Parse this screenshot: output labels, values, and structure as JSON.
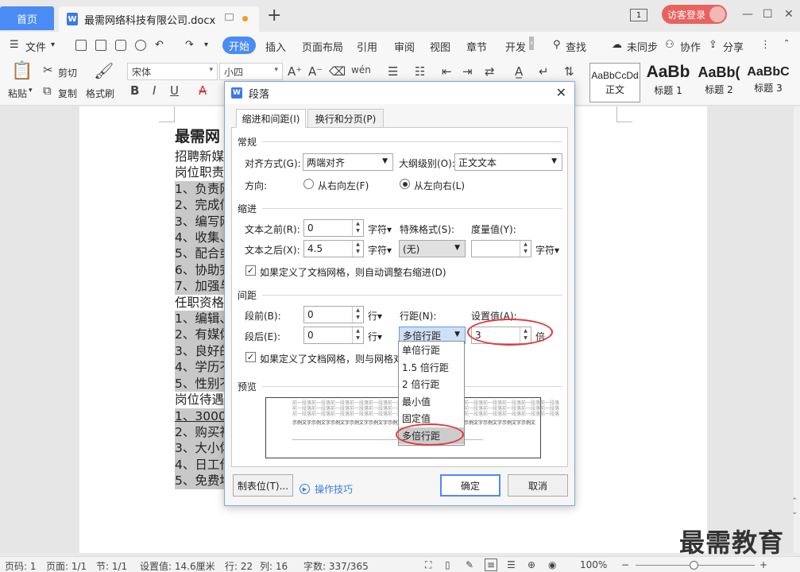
{
  "titlebar": {
    "home_tab": "首页",
    "doc_tab": "最需网络科技有限公司.docx",
    "doc_icon": "W",
    "add_tab": "+",
    "page_count": "1",
    "login": "访客登录",
    "minimize": "—",
    "maximize": "☐",
    "close": "✕"
  },
  "menubar": {
    "file": "文件",
    "start": "开始",
    "items": [
      "插入",
      "页面布局",
      "引用",
      "审阅",
      "视图",
      "章节",
      "开发"
    ],
    "search": "查找",
    "sync": "未同步",
    "collab": "协作",
    "share": "分享"
  },
  "ribbon": {
    "paste": "粘贴",
    "cut": "剪切",
    "copy": "复制",
    "format_painter": "格式刷",
    "font": "宋体",
    "size": "小四",
    "bold": "B",
    "italic": "I",
    "underline": "U",
    "strike": "A",
    "styles": [
      {
        "sample": "AaBbCcDd",
        "name": "正文"
      },
      {
        "sample": "AaBb",
        "name": "标题 1"
      },
      {
        "sample": "AaBb(",
        "name": "标题 2"
      },
      {
        "sample": "AaBbC",
        "name": "标题 3"
      }
    ]
  },
  "document": {
    "heading": "最需网",
    "lines": [
      "招聘新媒",
      "岗位职责",
      "1、负责网",
      "2、完成信",
      "3、编写网",
      "4、收集、",
      "5、配合或",
      "6、协助完",
      "7、加强与",
      "任职资格",
      "1、编辑、",
      "2、有媒体",
      "3、良好的",
      "4、学历不",
      "5、性别不",
      "岗位待遇",
      "1、3000",
      "2、购买社",
      "3、大小体",
      "4、日工作",
      "5、免费地"
    ],
    "watermark": "最需教育"
  },
  "dialog": {
    "title": "段落",
    "close": "✕",
    "tabs": [
      "缩进和间距(I)",
      "换行和分页(P)"
    ],
    "general": {
      "section": "常规",
      "align_label": "对齐方式(G):",
      "align_value": "两端对齐",
      "outline_label": "大纲级别(O):",
      "outline_value": "正文文本",
      "direction_label": "方向:",
      "rtl": "从右向左(F)",
      "ltr": "从左向右(L)"
    },
    "indent": {
      "section": "缩进",
      "before_label": "文本之前(R):",
      "before_value": "0",
      "after_label": "文本之后(X):",
      "after_value": "4.5",
      "unit": "字符▾",
      "special_label": "特殊格式(S):",
      "special_value": "(无)",
      "measure_label": "度量值(Y):",
      "measure_value": "",
      "measure_unit": "字符▾",
      "grid_check": "如果定义了文档网格，则自动调整右缩进(D)"
    },
    "spacing": {
      "section": "间距",
      "before_label": "段前(B):",
      "before_value": "0",
      "after_label": "段后(E):",
      "after_value": "0",
      "unit": "行▾",
      "line_label": "行距(N):",
      "line_value": "多倍行距",
      "set_label": "设置值(A):",
      "set_value": "3",
      "set_unit": "倍",
      "grid_check": "如果定义了文档网格，则与网格对"
    },
    "line_options": [
      "单倍行距",
      "1.5 倍行距",
      "2 倍行距",
      "最小值",
      "固定值",
      "多倍行距"
    ],
    "preview": {
      "section": "预览",
      "grey": "前一段落前一段落前一段落前一段落前一段落前一段落前一段落前一段落前一段落前一段落前一段落前一段落前一段落前一段落",
      "sample": "示例文字示例文字示例文字示例文字示例文字示例文字示例文字示例文字示例文字示例文字示例文字示例文字示例文"
    },
    "tab_button": "制表位(T)...",
    "tips": "操作技巧",
    "ok": "确定",
    "cancel": "取消"
  },
  "statusbar": {
    "page": "页码: 1",
    "pages": "页面: 1/1",
    "section": "节: 1/1",
    "setting": "设置值: 14.6厘米",
    "row": "行: 22",
    "col": "列: 16",
    "words": "字数: 337/365",
    "zoom": "100%",
    "zoom_out": "−",
    "zoom_in": "+"
  },
  "colors": {
    "accent": "#4b8bf4",
    "login": "#e8625e",
    "highlight_ring": "#e0393e"
  }
}
